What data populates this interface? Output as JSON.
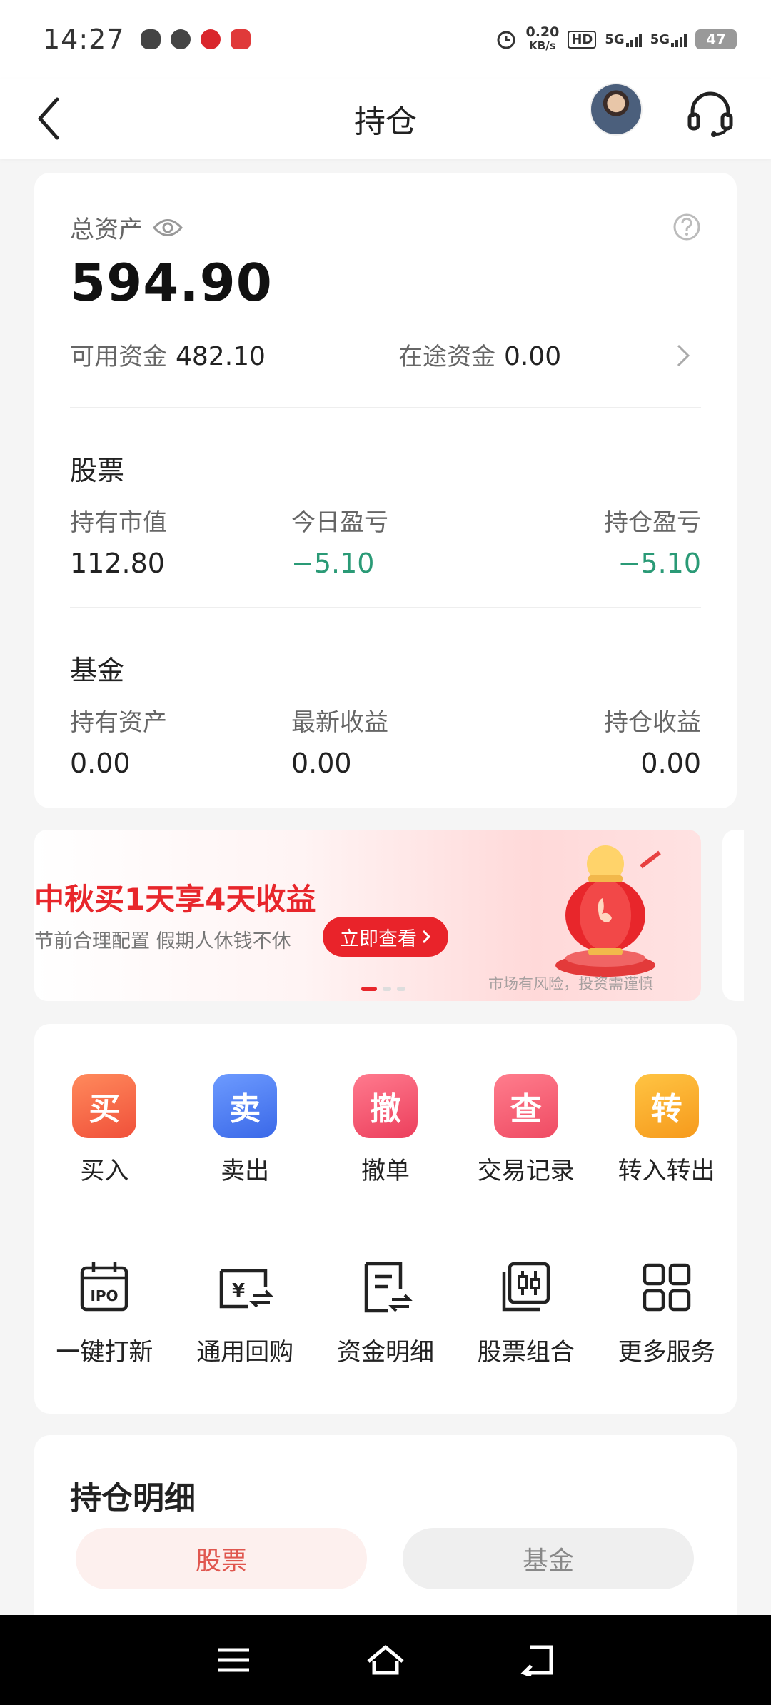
{
  "status_bar": {
    "time": "14:27",
    "net_speed_value": "0.20",
    "net_speed_unit": "KB/s",
    "hd_tag": "HD",
    "signal1": "5G",
    "signal2": "5G",
    "battery": "47"
  },
  "header": {
    "title": "持仓"
  },
  "assets": {
    "total_label": "总资产",
    "total_value": "594.90",
    "available_label": "可用资金",
    "available_value": "482.10",
    "transit_label": "在途资金",
    "transit_value": "0.00"
  },
  "stock": {
    "title": "股票",
    "market_value_label": "持有市值",
    "market_value": "112.80",
    "today_pl_label": "今日盈亏",
    "today_pl": "−5.10",
    "position_pl_label": "持仓盈亏",
    "position_pl": "−5.10"
  },
  "fund": {
    "title": "基金",
    "holding_label": "持有资产",
    "holding_value": "0.00",
    "latest_label": "最新收益",
    "latest_value": "0.00",
    "position_label": "持仓收益",
    "position_value": "0.00"
  },
  "banner": {
    "headline": "中秋买1天享4天收益",
    "subtitle": "节前合理配置 假期人休钱不休",
    "cta": "立即查看",
    "risk_note": "市场有风险，投资需谨慎"
  },
  "actions": [
    {
      "tile": "买",
      "label": "买入",
      "color": "#f4603f"
    },
    {
      "tile": "卖",
      "label": "卖出",
      "color": "#4b7bf0"
    },
    {
      "tile": "撤",
      "label": "撤单",
      "color": "#f2506c"
    },
    {
      "tile": "查",
      "label": "交易记录",
      "color": "#f0566a"
    },
    {
      "tile": "转",
      "label": "转入转出",
      "color": "#f7a522"
    }
  ],
  "services": [
    {
      "label": "一键打新",
      "icon": "ipo-calendar-icon"
    },
    {
      "label": "通用回购",
      "icon": "repo-yen-icon"
    },
    {
      "label": "资金明细",
      "icon": "fund-detail-doc-icon"
    },
    {
      "label": "股票组合",
      "icon": "stock-portfolio-icon"
    },
    {
      "label": "更多服务",
      "icon": "grid-more-icon"
    }
  ],
  "holdings": {
    "title": "持仓明细",
    "tab_stock": "股票",
    "tab_fund": "基金"
  },
  "colors": {
    "negative": "#2a9a76",
    "accent_red": "#e8262b"
  }
}
